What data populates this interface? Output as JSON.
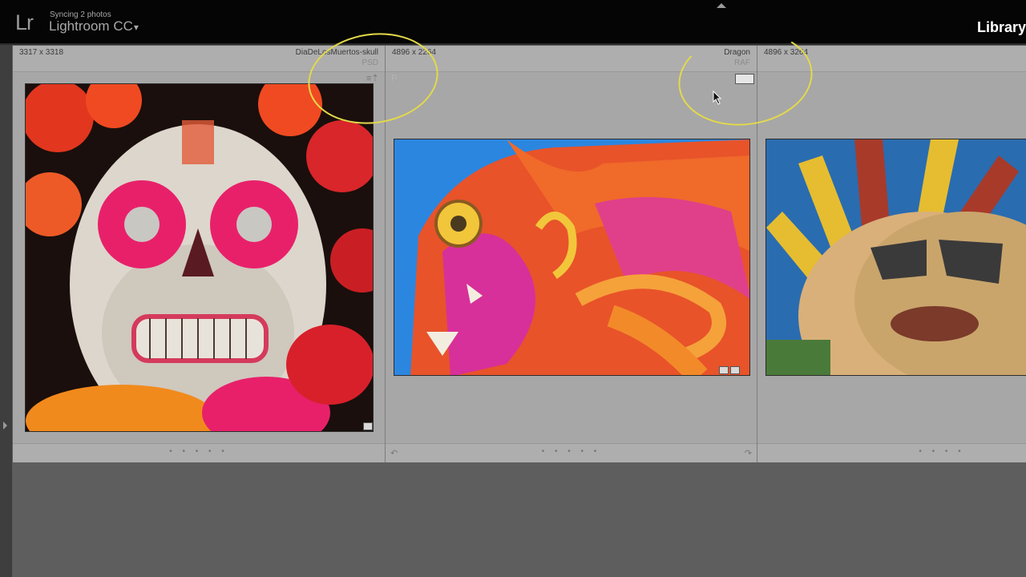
{
  "app": {
    "logo": "Lr",
    "sync_status": "Syncing 2 photos",
    "name": "Lightroom CC",
    "caret": "▾",
    "module": "Library"
  },
  "cells": [
    {
      "dimensions": "3317 x 3318",
      "filename": "DiaDeLosMuertos-skull",
      "filetype": "PSD",
      "rating_dots": "• • • • •"
    },
    {
      "dimensions": "4896 x 2264",
      "filename": "Dragon",
      "filetype": "RAF",
      "rating_dots": "• • • • •"
    },
    {
      "dimensions": "4896 x 3264",
      "filename": "",
      "filetype": "",
      "rating_dots": "• • • •"
    }
  ],
  "colors": {
    "annotation": "#e3d94a",
    "topbar": "#050505",
    "grid_bg": "#a7a7a7"
  }
}
